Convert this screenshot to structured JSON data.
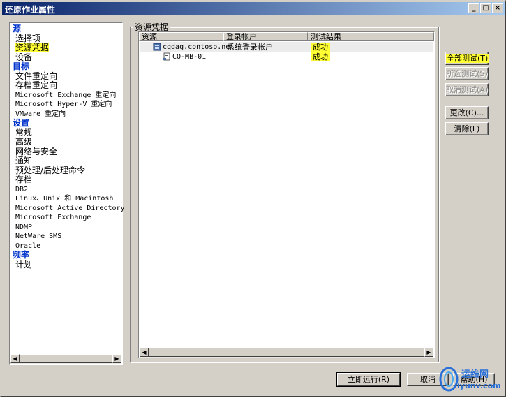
{
  "window": {
    "title": "还原作业属性"
  },
  "titlebar_buttons": {
    "minimize": "_",
    "maximize": "□",
    "close": "×"
  },
  "nav": {
    "sections": [
      {
        "header": "源",
        "items": [
          "选择项",
          "资源凭据",
          "设备"
        ]
      },
      {
        "header": "目标",
        "items": [
          "文件重定向",
          "存档重定向",
          "Microsoft Exchange 重定向",
          "Microsoft Hyper-V 重定向",
          "VMware 重定向"
        ]
      },
      {
        "header": "设置",
        "items": [
          "常规",
          "高级",
          "网络与安全",
          "通知",
          "预处理/后处理命令",
          "存档",
          "DB2",
          "Linux、Unix 和 Macintosh",
          "Microsoft Active Directory",
          "Microsoft Exchange",
          "NDMP",
          "NetWare SMS",
          "Oracle"
        ]
      },
      {
        "header": "频率",
        "items": [
          "计划"
        ]
      }
    ],
    "selected": "资源凭据"
  },
  "content": {
    "group_title": "资源凭据",
    "columns": [
      "资源",
      "登录帐户",
      "测试结果"
    ],
    "rows": [
      {
        "resource": "cqdag.contoso.net",
        "account": "系统登录帐户",
        "result": "成功",
        "indent": 0,
        "icon": "server-icon"
      },
      {
        "resource": "CQ-MB-01",
        "account": "",
        "result": "成功",
        "indent": 1,
        "icon": "document-icon"
      }
    ]
  },
  "side_buttons": {
    "test_all": "全部测试(T)",
    "test_selected": "所选测试(S)",
    "cancel_test": "取消测试(A)",
    "change": "更改(C)...",
    "clear": "清除(L)"
  },
  "footer_buttons": {
    "run_now": "立即运行(R)",
    "cancel": "取消",
    "help": "帮助(H)"
  },
  "watermark": {
    "text": "运维网",
    "url": "iyunv.com"
  },
  "colors": {
    "highlight": "#ffff33",
    "title_start": "#0a246a",
    "header_blue": "#0033cc"
  }
}
